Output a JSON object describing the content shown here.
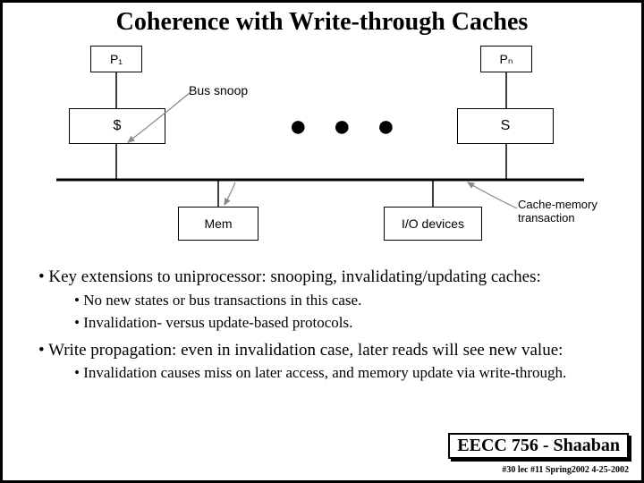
{
  "title": "Coherence with Write-through Caches",
  "diagram": {
    "p1": "P₁",
    "pn": "Pₙ",
    "cache1": "$",
    "cache2": "S",
    "bus_snoop": "Bus snoop",
    "mem": "Mem",
    "io": "I/O devices",
    "cache_mem_txn_l1": "Cache-memory",
    "cache_mem_txn_l2": "transaction",
    "dots": "● ● ●"
  },
  "bullets": {
    "b1": "Key extensions to uniprocessor: snooping, invalidating/updating caches:",
    "b1a": "No new states or bus transactions in this case.",
    "b1b": "Invalidation- versus update-based protocols.",
    "b2": "Write propagation: even in invalidation case, later reads will see new value:",
    "b2a": "Invalidation causes miss on later access, and memory update via write-through."
  },
  "footer": {
    "course": "EECC 756 - Shaaban",
    "small": "#30  lec #11   Spring2002  4-25-2002"
  }
}
